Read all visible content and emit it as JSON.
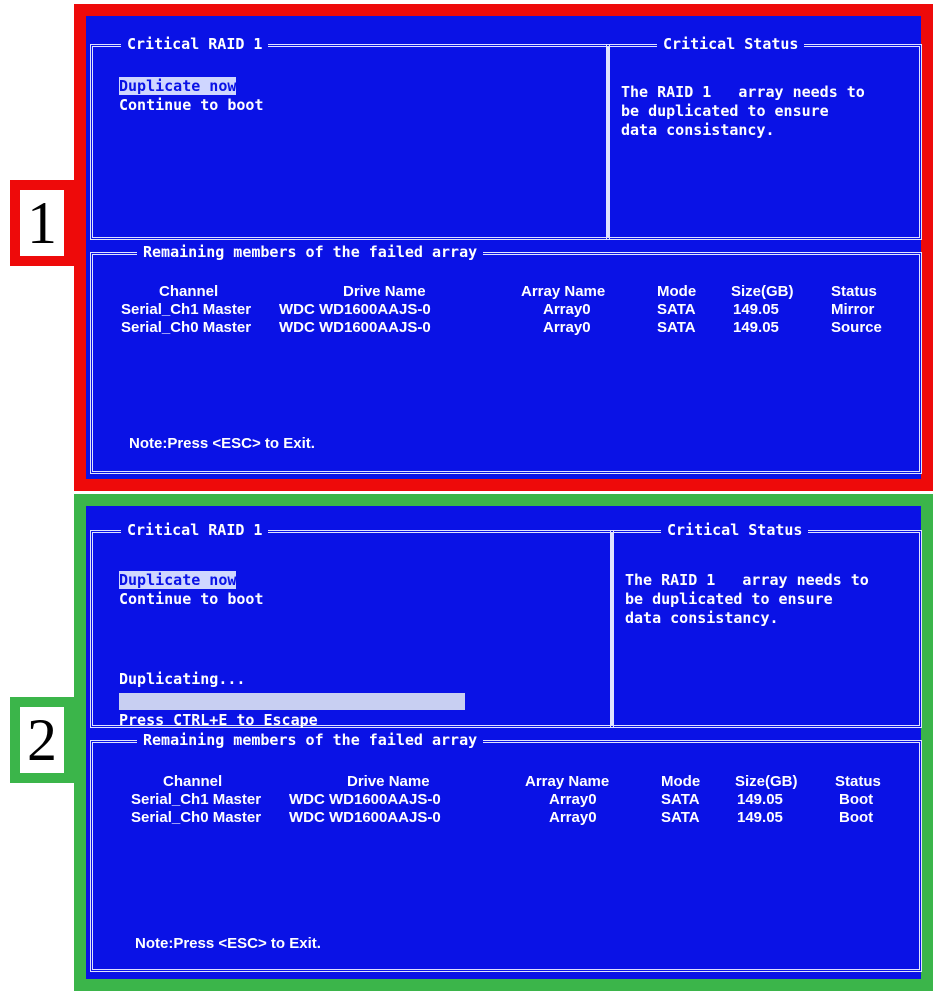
{
  "badges": {
    "one": "1",
    "two": "2"
  },
  "panel1": {
    "menu_title": "Critical RAID 1",
    "menu_items": [
      "Duplicate now",
      "Continue to boot"
    ],
    "status_title": "Critical Status",
    "status_lines": [
      "The RAID 1   array needs to",
      "be duplicated to ensure",
      "data consistancy."
    ],
    "members_title": "Remaining members of the failed array",
    "headers": [
      "Channel",
      "Drive Name",
      "Array Name",
      "Mode",
      "Size(GB)",
      "Status"
    ],
    "rows": [
      {
        "channel": "Serial_Ch1 Master",
        "drive": "WDC WD1600AAJS-0",
        "array": "Array0",
        "mode": "SATA",
        "size": "149.05",
        "status": "Mirror"
      },
      {
        "channel": "Serial_Ch0 Master",
        "drive": "WDC WD1600AAJS-0",
        "array": "Array0",
        "mode": "SATA",
        "size": "149.05",
        "status": "Source"
      }
    ],
    "note": "Note:Press <ESC> to Exit."
  },
  "panel2": {
    "menu_title": "Critical RAID 1",
    "menu_items": [
      "Duplicate now",
      "Continue to boot"
    ],
    "duplicating": "Duplicating...",
    "escape_hint": "Press CTRL+E to Escape",
    "status_title": "Critical Status",
    "status_lines": [
      "The RAID 1   array needs to",
      "be duplicated to ensure",
      "data consistancy."
    ],
    "members_title": "Remaining members of the failed array",
    "headers": [
      "Channel",
      "Drive Name",
      "Array Name",
      "Mode",
      "Size(GB)",
      "Status"
    ],
    "rows": [
      {
        "channel": "Serial_Ch1 Master",
        "drive": "WDC WD1600AAJS-0",
        "array": "Array0",
        "mode": "SATA",
        "size": "149.05",
        "status": "Boot"
      },
      {
        "channel": "Serial_Ch0 Master",
        "drive": "WDC WD1600AAJS-0",
        "array": "Array0",
        "mode": "SATA",
        "size": "149.05",
        "status": "Boot"
      }
    ],
    "note": "Note:Press <ESC> to Exit."
  },
  "colors": {
    "bios_blue": "#0a12e6",
    "red_frame": "#ee0a0a",
    "green_frame": "#3bb54a"
  }
}
